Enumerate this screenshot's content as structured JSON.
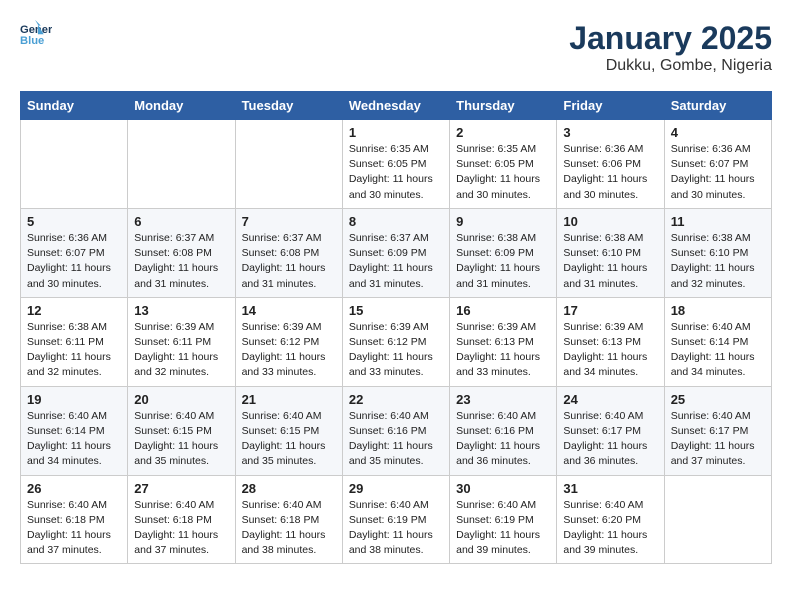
{
  "logo": {
    "line1": "General",
    "line2": "Blue"
  },
  "title": "January 2025",
  "subtitle": "Dukku, Gombe, Nigeria",
  "weekdays": [
    "Sunday",
    "Monday",
    "Tuesday",
    "Wednesday",
    "Thursday",
    "Friday",
    "Saturday"
  ],
  "weeks": [
    [
      {
        "day": "",
        "info": ""
      },
      {
        "day": "",
        "info": ""
      },
      {
        "day": "",
        "info": ""
      },
      {
        "day": "1",
        "info": "Sunrise: 6:35 AM\nSunset: 6:05 PM\nDaylight: 11 hours\nand 30 minutes."
      },
      {
        "day": "2",
        "info": "Sunrise: 6:35 AM\nSunset: 6:05 PM\nDaylight: 11 hours\nand 30 minutes."
      },
      {
        "day": "3",
        "info": "Sunrise: 6:36 AM\nSunset: 6:06 PM\nDaylight: 11 hours\nand 30 minutes."
      },
      {
        "day": "4",
        "info": "Sunrise: 6:36 AM\nSunset: 6:07 PM\nDaylight: 11 hours\nand 30 minutes."
      }
    ],
    [
      {
        "day": "5",
        "info": "Sunrise: 6:36 AM\nSunset: 6:07 PM\nDaylight: 11 hours\nand 30 minutes."
      },
      {
        "day": "6",
        "info": "Sunrise: 6:37 AM\nSunset: 6:08 PM\nDaylight: 11 hours\nand 31 minutes."
      },
      {
        "day": "7",
        "info": "Sunrise: 6:37 AM\nSunset: 6:08 PM\nDaylight: 11 hours\nand 31 minutes."
      },
      {
        "day": "8",
        "info": "Sunrise: 6:37 AM\nSunset: 6:09 PM\nDaylight: 11 hours\nand 31 minutes."
      },
      {
        "day": "9",
        "info": "Sunrise: 6:38 AM\nSunset: 6:09 PM\nDaylight: 11 hours\nand 31 minutes."
      },
      {
        "day": "10",
        "info": "Sunrise: 6:38 AM\nSunset: 6:10 PM\nDaylight: 11 hours\nand 31 minutes."
      },
      {
        "day": "11",
        "info": "Sunrise: 6:38 AM\nSunset: 6:10 PM\nDaylight: 11 hours\nand 32 minutes."
      }
    ],
    [
      {
        "day": "12",
        "info": "Sunrise: 6:38 AM\nSunset: 6:11 PM\nDaylight: 11 hours\nand 32 minutes."
      },
      {
        "day": "13",
        "info": "Sunrise: 6:39 AM\nSunset: 6:11 PM\nDaylight: 11 hours\nand 32 minutes."
      },
      {
        "day": "14",
        "info": "Sunrise: 6:39 AM\nSunset: 6:12 PM\nDaylight: 11 hours\nand 33 minutes."
      },
      {
        "day": "15",
        "info": "Sunrise: 6:39 AM\nSunset: 6:12 PM\nDaylight: 11 hours\nand 33 minutes."
      },
      {
        "day": "16",
        "info": "Sunrise: 6:39 AM\nSunset: 6:13 PM\nDaylight: 11 hours\nand 33 minutes."
      },
      {
        "day": "17",
        "info": "Sunrise: 6:39 AM\nSunset: 6:13 PM\nDaylight: 11 hours\nand 34 minutes."
      },
      {
        "day": "18",
        "info": "Sunrise: 6:40 AM\nSunset: 6:14 PM\nDaylight: 11 hours\nand 34 minutes."
      }
    ],
    [
      {
        "day": "19",
        "info": "Sunrise: 6:40 AM\nSunset: 6:14 PM\nDaylight: 11 hours\nand 34 minutes."
      },
      {
        "day": "20",
        "info": "Sunrise: 6:40 AM\nSunset: 6:15 PM\nDaylight: 11 hours\nand 35 minutes."
      },
      {
        "day": "21",
        "info": "Sunrise: 6:40 AM\nSunset: 6:15 PM\nDaylight: 11 hours\nand 35 minutes."
      },
      {
        "day": "22",
        "info": "Sunrise: 6:40 AM\nSunset: 6:16 PM\nDaylight: 11 hours\nand 35 minutes."
      },
      {
        "day": "23",
        "info": "Sunrise: 6:40 AM\nSunset: 6:16 PM\nDaylight: 11 hours\nand 36 minutes."
      },
      {
        "day": "24",
        "info": "Sunrise: 6:40 AM\nSunset: 6:17 PM\nDaylight: 11 hours\nand 36 minutes."
      },
      {
        "day": "25",
        "info": "Sunrise: 6:40 AM\nSunset: 6:17 PM\nDaylight: 11 hours\nand 37 minutes."
      }
    ],
    [
      {
        "day": "26",
        "info": "Sunrise: 6:40 AM\nSunset: 6:18 PM\nDaylight: 11 hours\nand 37 minutes."
      },
      {
        "day": "27",
        "info": "Sunrise: 6:40 AM\nSunset: 6:18 PM\nDaylight: 11 hours\nand 37 minutes."
      },
      {
        "day": "28",
        "info": "Sunrise: 6:40 AM\nSunset: 6:18 PM\nDaylight: 11 hours\nand 38 minutes."
      },
      {
        "day": "29",
        "info": "Sunrise: 6:40 AM\nSunset: 6:19 PM\nDaylight: 11 hours\nand 38 minutes."
      },
      {
        "day": "30",
        "info": "Sunrise: 6:40 AM\nSunset: 6:19 PM\nDaylight: 11 hours\nand 39 minutes."
      },
      {
        "day": "31",
        "info": "Sunrise: 6:40 AM\nSunset: 6:20 PM\nDaylight: 11 hours\nand 39 minutes."
      },
      {
        "day": "",
        "info": ""
      }
    ]
  ]
}
